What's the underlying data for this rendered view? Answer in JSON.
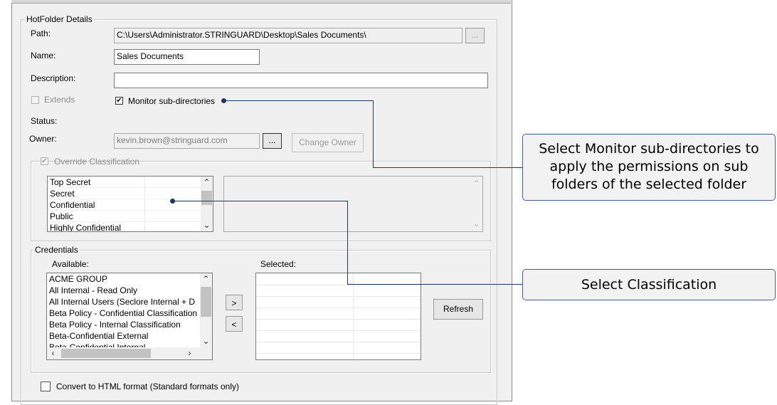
{
  "details": {
    "legend": "HotFolder Details",
    "path_label": "Path:",
    "path_value": "C:\\Users\\Administrator.STRINGUARD\\Desktop\\Sales Documents\\",
    "browse_label": "...",
    "name_label": "Name:",
    "name_value": "Sales Documents",
    "description_label": "Description:",
    "description_value": "",
    "extends_label": "Extends",
    "monitor_label": "Monitor sub-directories",
    "monitor_checked": true,
    "status_label": "Status:",
    "owner_label": "Owner:",
    "owner_value": "kevin.brown@stringuard.com",
    "owner_browse_label": "...",
    "change_owner_label": "Change Owner"
  },
  "classification": {
    "legend": "Override Classification",
    "checked": true,
    "items": [
      "Top Secret",
      "Secret",
      "Confidential",
      "Public",
      "Highly Confidential"
    ]
  },
  "credentials": {
    "legend": "Credentials",
    "available_label": "Available:",
    "selected_label": "Selected:",
    "available_items": [
      "ACME GROUP",
      "All Internal - Read Only",
      "All Internal Users (Seclore Internal + D",
      "Beta Policy - Confidential Classification",
      "Beta Policy - Internal Classification",
      "Beta-Confidential External",
      "Beta-Confidential Internal"
    ],
    "add_label": ">",
    "remove_label": "<",
    "refresh_label": "Refresh"
  },
  "convert": {
    "label": "Convert to HTML format (Standard formats only)",
    "checked": false
  },
  "callouts": {
    "monitor_text": "Select Monitor sub-directories to apply the permissions on sub folders of the selected folder",
    "classification_text": "Select Classification"
  },
  "colors": {
    "callout_border": "#4a6088",
    "connector": "#1f3864",
    "window_bg": "#f0f0f0"
  }
}
